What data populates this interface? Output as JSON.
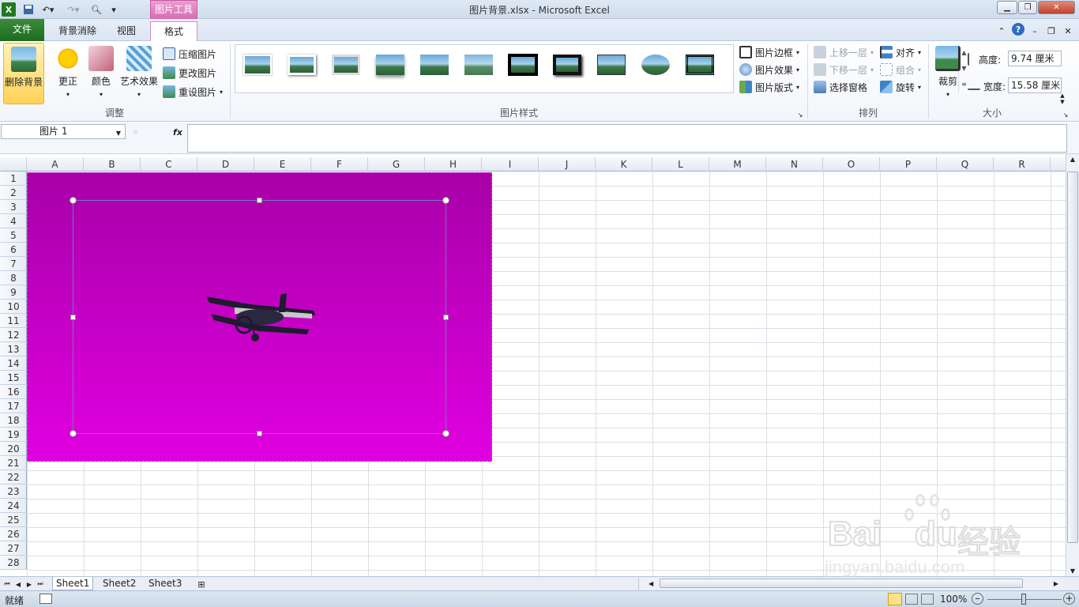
{
  "window": {
    "title": "图片背景.xlsx  -  Microsoft Excel",
    "context_tab_group": "图片工具"
  },
  "tabs": [
    {
      "label": "文件"
    },
    {
      "label": "背景消除"
    },
    {
      "label": "视图"
    },
    {
      "label": "格式",
      "active": true
    }
  ],
  "ribbon": {
    "adjust": {
      "label": "调整",
      "remove_bg": "删除背景",
      "corrections": "更正",
      "color": "颜色",
      "artistic": "艺术效果",
      "compress": "压缩图片",
      "change": "更改图片",
      "reset": "重设图片"
    },
    "styles": {
      "label": "图片样式",
      "border": "图片边框",
      "effects": "图片效果",
      "layout": "图片版式"
    },
    "arrange": {
      "label": "排列",
      "bring_forward": "上移一层",
      "send_backward": "下移一层",
      "selection_pane": "选择窗格",
      "align": "对齐",
      "group": "组合",
      "rotate": "旋转"
    },
    "size": {
      "label": "大小",
      "crop": "裁剪",
      "height_label": "高度:",
      "height_value": "9.74 厘米",
      "width_label": "宽度:",
      "width_value": "15.58 厘米"
    }
  },
  "formula_bar": {
    "name_box": "图片  1",
    "fx": "fx"
  },
  "grid": {
    "columns": [
      "A",
      "B",
      "C",
      "D",
      "E",
      "F",
      "G",
      "H",
      "I",
      "J",
      "K",
      "L",
      "M",
      "N",
      "O",
      "P",
      "Q",
      "R"
    ],
    "rows": [
      "1",
      "2",
      "3",
      "4",
      "5",
      "6",
      "7",
      "8",
      "9",
      "10",
      "11",
      "12",
      "13",
      "14",
      "15",
      "16",
      "17",
      "18",
      "19",
      "20",
      "21",
      "22",
      "23",
      "24",
      "25",
      "26",
      "27",
      "28"
    ]
  },
  "sheets": [
    "Sheet1",
    "Sheet2",
    "Sheet3"
  ],
  "status": {
    "ready": "就绪",
    "zoom": "100%"
  },
  "watermark": {
    "brand": "Bai",
    "brand2": "du",
    "cn": "经验",
    "url": "jingyan.baidu.com"
  },
  "colors": {
    "picture_top": "#a800a8",
    "picture_bottom": "#e000e0",
    "file_tab": "#2a7a2a",
    "context_tab": "#d96bb5"
  }
}
